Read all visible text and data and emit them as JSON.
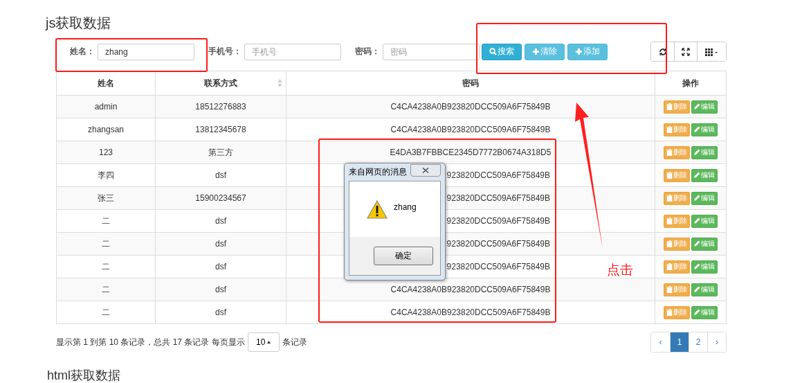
{
  "page_title": "js获取数据",
  "search_form": {
    "fields": [
      {
        "label": "姓名：",
        "value": "zhang"
      },
      {
        "label": "手机号：",
        "placeholder": "手机号"
      },
      {
        "label": "密码：",
        "placeholder": "密码"
      }
    ],
    "buttons": [
      {
        "label": "搜索",
        "kind": "search",
        "active": true
      },
      {
        "label": "清除",
        "kind": "plus",
        "active": false
      },
      {
        "label": "添加",
        "kind": "plus",
        "active": false
      }
    ]
  },
  "table": {
    "columns": [
      {
        "label": "姓名",
        "sortable": false
      },
      {
        "label": "联系方式",
        "sortable": true
      },
      {
        "label": "密码",
        "sortable": false
      },
      {
        "label": "操作",
        "sortable": false
      }
    ],
    "rows": [
      {
        "name": "admin",
        "contact": "18512276883",
        "password": "C4CA4238A0B923820DCC509A6F75849B",
        "covered": false,
        "actions": [
          "删除",
          "编辑"
        ]
      },
      {
        "name": "zhangsan",
        "contact": "13812345678",
        "password": "C4CA4238A0B923820DCC509A6F75849B",
        "covered": false,
        "actions": [
          "删除",
          "编辑"
        ]
      },
      {
        "name": "123",
        "contact": "第三方",
        "password": "E4DA3B7FBBCE2345D7772B0674A318D5",
        "covered": false,
        "actions": [
          "删除",
          "编辑"
        ]
      },
      {
        "name": "李四",
        "contact": "dsf",
        "password": "923820DCC509A6F75849B",
        "covered": true,
        "actions": [
          "删除",
          "编辑"
        ]
      },
      {
        "name": "张三",
        "contact": "15900234567",
        "password": "923820DCC509A6F75849B",
        "covered": true,
        "actions": [
          "删除",
          "编辑"
        ]
      },
      {
        "name": "二",
        "contact": "dsf",
        "password": "923820DCC509A6F75849B",
        "covered": true,
        "actions": [
          "删除",
          "编辑"
        ]
      },
      {
        "name": "二",
        "contact": "dsf",
        "password": "923820DCC509A6F75849B",
        "covered": true,
        "actions": [
          "删除",
          "编辑"
        ]
      },
      {
        "name": "二",
        "contact": "dsf",
        "password": "923820DCC509A6F75849B",
        "covered": true,
        "actions": [
          "删除",
          "编辑"
        ]
      },
      {
        "name": "二",
        "contact": "dsf",
        "password": "C4CA4238A0B923820DCC509A6F75849B",
        "covered": false,
        "actions": [
          "删除",
          "编辑"
        ]
      },
      {
        "name": "二",
        "contact": "dsf",
        "password": "C4CA4238A0B923820DCC509A6F75849B",
        "covered": false,
        "actions": [
          "删除",
          "编辑"
        ]
      }
    ]
  },
  "pagination": {
    "info": "显示第 1 到第 10 条记录，总共 17 条记录 每页显示",
    "page_size": "10",
    "suffix": "条记录",
    "pages": [
      {
        "label": "‹",
        "selected": false
      },
      {
        "label": "1",
        "selected": true
      },
      {
        "label": "2",
        "selected": false
      },
      {
        "label": "›",
        "selected": false
      }
    ]
  },
  "dialog": {
    "title": "来自网页的消息",
    "message": "zhang",
    "button": "确定"
  },
  "annotation": {
    "label": "点击"
  },
  "next_heading": "html获取数据"
}
